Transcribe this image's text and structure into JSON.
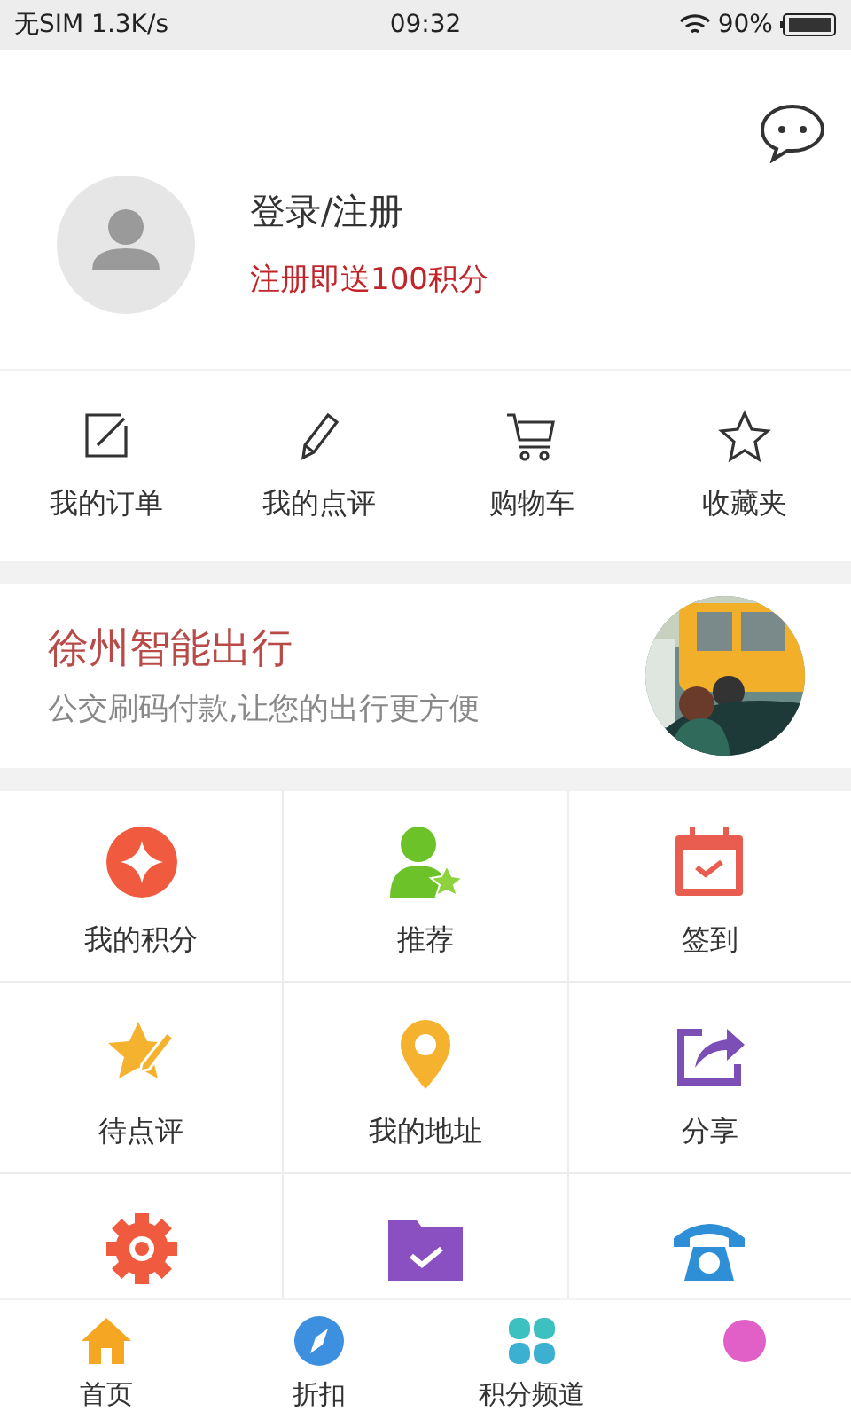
{
  "status_bar": {
    "carrier": "无SIM 1.3K/s",
    "time": "09:32",
    "battery": "90%"
  },
  "profile": {
    "login": "登录/注册",
    "promo": "注册即送100积分"
  },
  "quick_actions": [
    {
      "kind": "order",
      "label": "我的订单"
    },
    {
      "kind": "review",
      "label": "我的点评"
    },
    {
      "kind": "cart",
      "label": "购物车"
    },
    {
      "kind": "favorite",
      "label": "收藏夹"
    }
  ],
  "banner": {
    "title": "徐州智能出行",
    "subtitle": "公交刷码付款,让您的出行更方便"
  },
  "grid": [
    {
      "kind": "points",
      "label": "我的积分"
    },
    {
      "kind": "recommend",
      "label": "推荐"
    },
    {
      "kind": "checkin",
      "label": "签到"
    },
    {
      "kind": "pending",
      "label": "待点评"
    },
    {
      "kind": "address",
      "label": "我的地址"
    },
    {
      "kind": "share",
      "label": "分享"
    },
    {
      "kind": "settings"
    },
    {
      "kind": "folder"
    },
    {
      "kind": "phone"
    }
  ],
  "bottom_nav": [
    {
      "kind": "home",
      "label": "首页"
    },
    {
      "kind": "discount",
      "label": "折扣"
    },
    {
      "kind": "channel",
      "label": "积分频道"
    },
    {
      "kind": "profile"
    }
  ]
}
